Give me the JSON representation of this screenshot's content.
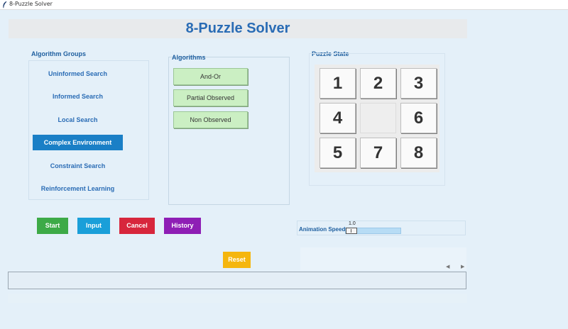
{
  "window": {
    "title": "8-Puzzle Solver"
  },
  "header": {
    "title": "8-Puzzle Solver"
  },
  "groups": {
    "heading": "Algorithm Groups",
    "items": [
      {
        "label": "Uninformed Search",
        "active": false
      },
      {
        "label": "Informed Search",
        "active": false
      },
      {
        "label": "Local Search",
        "active": false
      },
      {
        "label": "Complex Environment",
        "active": true
      },
      {
        "label": "Constraint Search",
        "active": false
      },
      {
        "label": "Reinforcement Learning",
        "active": false
      }
    ]
  },
  "algorithms": {
    "heading": "Algorithms",
    "items": [
      "And-Or",
      "Partial Observed",
      "Non Observed"
    ]
  },
  "puzzle": {
    "heading": "Puzzle State",
    "tiles": [
      "1",
      "2",
      "3",
      "4",
      "",
      "6",
      "5",
      "7",
      "8"
    ]
  },
  "actions": {
    "start": "Start",
    "input": "Input",
    "cancel": "Cancel",
    "history": "History",
    "reset": "Reset"
  },
  "speed": {
    "label": "Animation Speed",
    "value": "1.0"
  },
  "colors": {
    "title": "#2a6cb5",
    "active_group": "#1a7fc6",
    "algo_button": "#cbefc3",
    "start": "#3daa47",
    "input": "#1a9fd9",
    "cancel": "#d7263c",
    "history": "#8e1eb5",
    "reset": "#f5b60e"
  },
  "icons": {
    "app": "feather-icon",
    "scroll_left": "arrow-left-icon",
    "scroll_right": "arrow-right-icon"
  }
}
